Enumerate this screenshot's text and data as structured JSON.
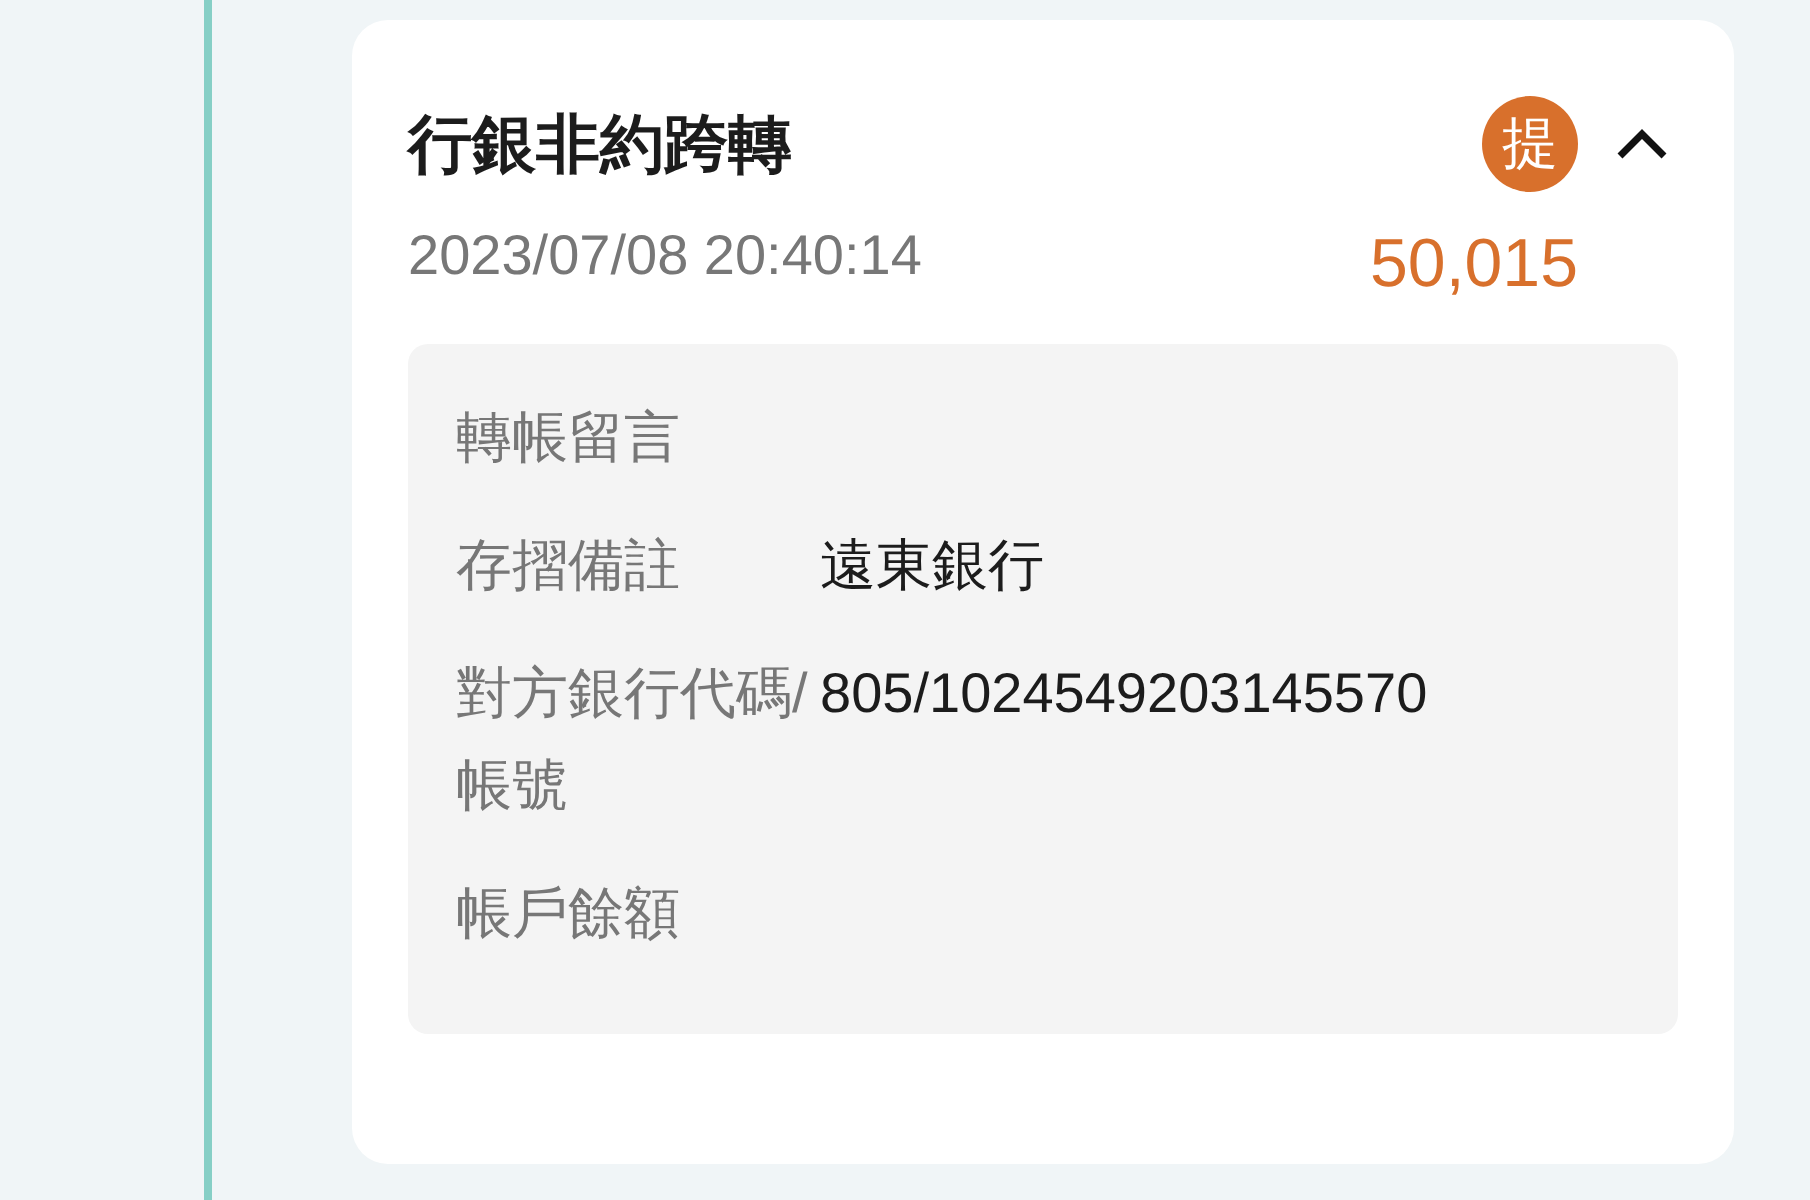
{
  "transaction": {
    "title": "行銀非約跨轉",
    "badge": "提",
    "expanded": true,
    "datetime": "2023/07/08 20:40:14",
    "amount": "50,015",
    "details": [
      {
        "label": "轉帳留言"
      },
      {
        "label": "存摺備註",
        "value": "遠東銀行"
      },
      {
        "label": "對方銀行代碼/帳號",
        "value": "805/1024549203145570"
      },
      {
        "label": "帳戶餘額"
      }
    ]
  }
}
